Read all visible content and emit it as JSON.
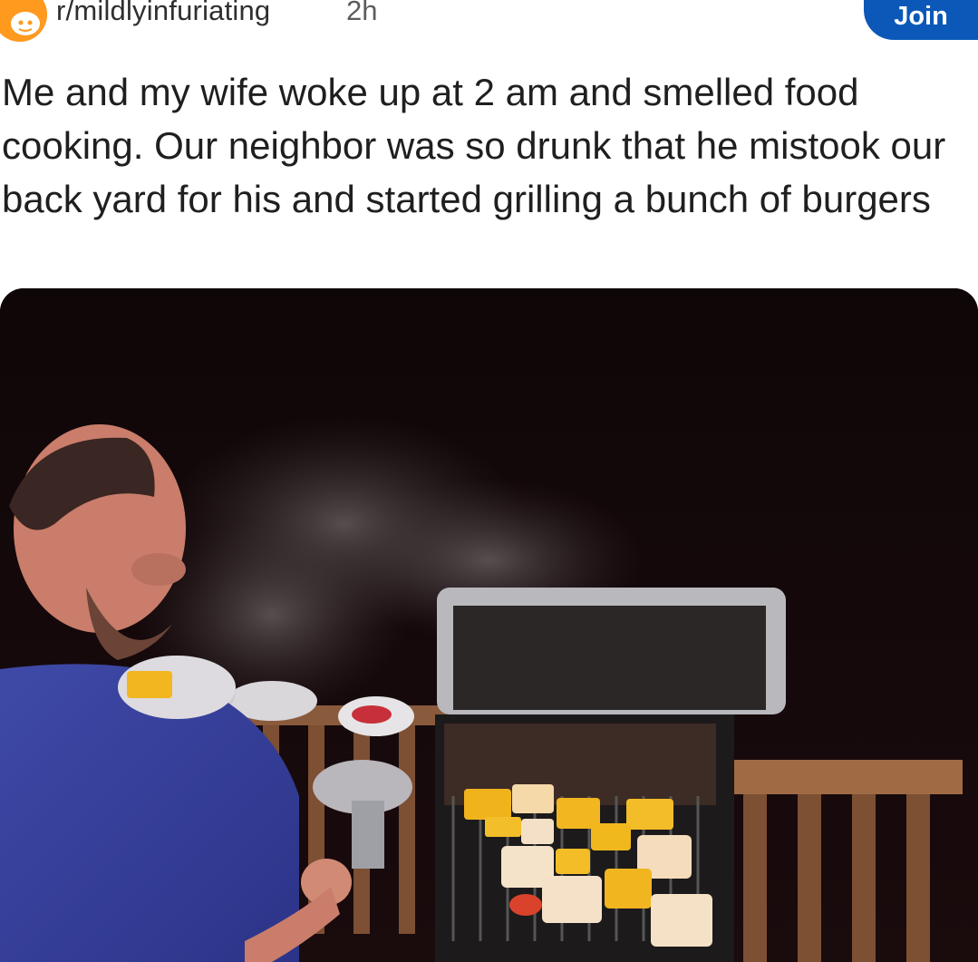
{
  "post": {
    "subreddit": "r/mildlyinfuriating",
    "time_ago": "2h",
    "join_label": "Join",
    "title": "Me and my wife woke up at 2 am and smelled food cooking. Our neighbor was so drunk that he mistook our back yard for his and started grilling a bunch of burgers"
  },
  "icons": {
    "subreddit_avatar": "reddit-snoo-icon"
  },
  "colors": {
    "join_button": "#0b58b8",
    "avatar": "#ff9a1f"
  }
}
